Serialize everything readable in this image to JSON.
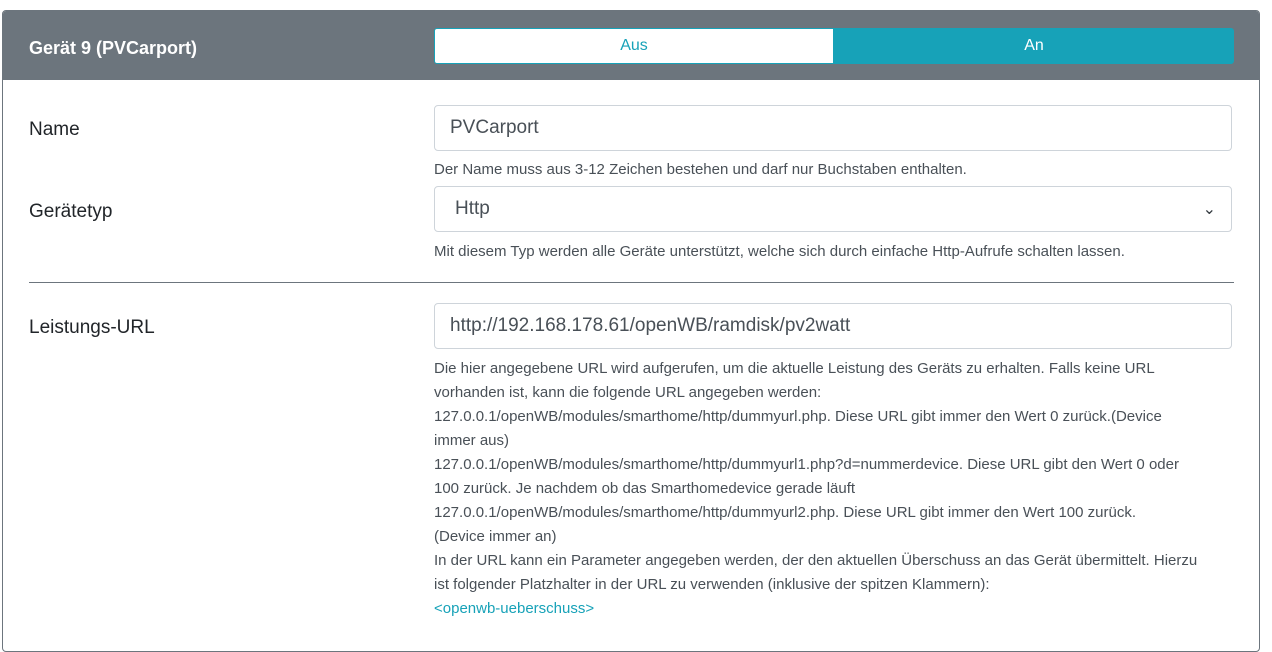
{
  "device": {
    "title": "Gerät 9 (PVCarport)",
    "toggle": {
      "off_label": "Aus",
      "on_label": "An",
      "selected": "An"
    }
  },
  "name_field": {
    "label": "Name",
    "value": "PVCarport",
    "help": "Der Name muss aus 3-12 Zeichen bestehen und darf nur Buchstaben enthalten."
  },
  "type_field": {
    "label": "Gerätetyp",
    "value": "Http",
    "help": "Mit diesem Typ werden alle Geräte unterstützt, welche sich durch einfache Http-Aufrufe schalten lassen."
  },
  "url_field": {
    "label": "Leistungs-URL",
    "value": "http://192.168.178.61/openWB/ramdisk/pv2watt",
    "help_lines": [
      "Die hier angegebene URL wird aufgerufen, um die aktuelle Leistung des Geräts zu erhalten. Falls keine URL",
      "vorhanden ist, kann die folgende URL angegeben werden:",
      "127.0.0.1/openWB/modules/smarthome/http/dummyurl.php. Diese URL gibt immer den Wert 0 zurück.(Device",
      "immer aus)",
      "127.0.0.1/openWB/modules/smarthome/http/dummyurl1.php?d=nummerdevice. Diese URL gibt den Wert 0 oder",
      "100 zurück. Je nachdem ob das Smarthomedevice gerade läuft",
      "127.0.0.1/openWB/modules/smarthome/http/dummyurl2.php. Diese URL gibt immer den Wert 100 zurück.",
      "(Device immer an)",
      "In der URL kann ein Parameter angegeben werden, der den aktuellen Überschuss an das Gerät übermittelt. Hierzu",
      "ist folgender Platzhalter in der URL zu verwenden (inklusive der spitzen Klammern):"
    ],
    "placeholder_token": "<openwb-ueberschuss>"
  },
  "colors": {
    "header": "#6c757d",
    "accent": "#17a2b8"
  }
}
